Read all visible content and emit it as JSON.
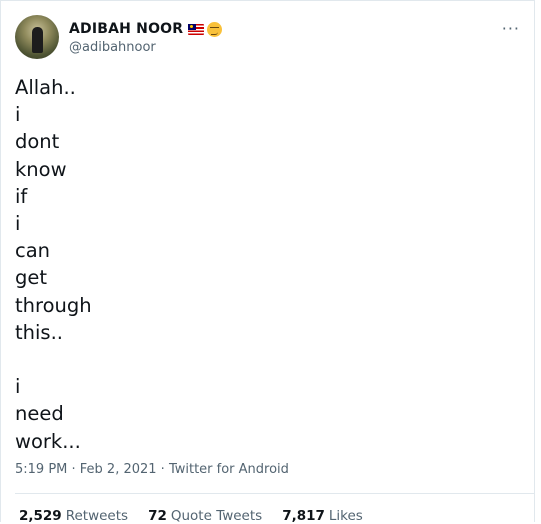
{
  "tweet": {
    "author_name": "ADIBAH NOOR",
    "author_handle": "@adibahnoor",
    "text": "Allah..\ni\ndont\nknow\nif\ni\ncan\nget\nthrough\nthis..\n\ni\nneed\nwork...",
    "timestamp": "5:19 PM · Feb 2, 2021 · Twitter for Android",
    "more_label": "···"
  },
  "stats": {
    "retweets_count": "2,529",
    "retweets_label": "Retweets",
    "quotes_count": "72",
    "quotes_label": "Quote Tweets",
    "likes_count": "7,817",
    "likes_label": "Likes"
  },
  "icons": [
    "malaysia-flag-icon",
    "smirk-face-icon"
  ],
  "colors": {
    "secondary_text": "#536471",
    "border": "#e1e8ed"
  }
}
